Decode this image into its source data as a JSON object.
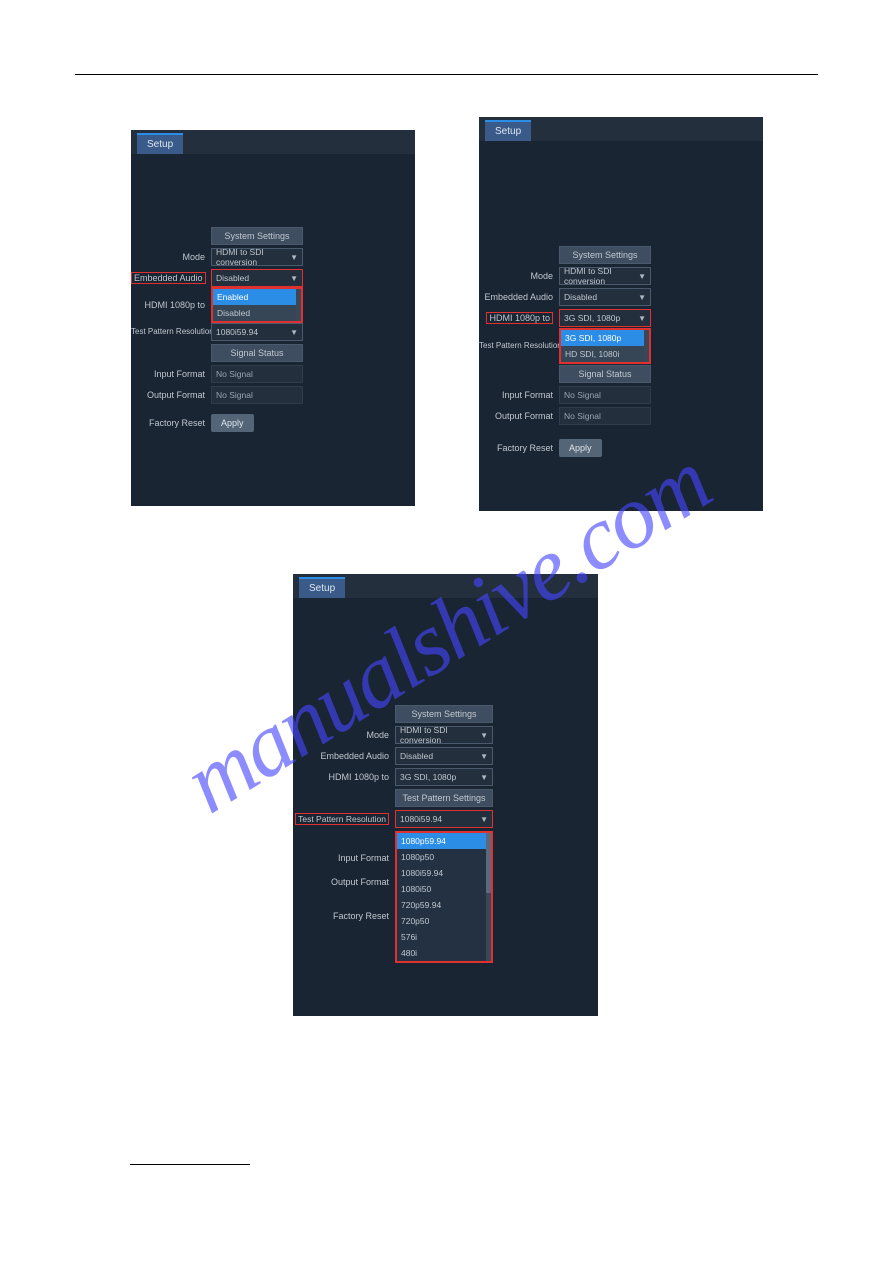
{
  "watermark": "manualshive.com",
  "tab_label": "Setup",
  "headers": {
    "system_settings": "System Settings",
    "test_pattern_settings": "Test Pattern Settings",
    "signal_status": "Signal Status"
  },
  "labels": {
    "mode": "Mode",
    "embedded_audio": "Embedded Audio",
    "hdmi_1080p_to": "HDMI 1080p to",
    "test_pattern_resolution": "Test Pattern Resolution",
    "input_format": "Input Format",
    "output_format": "Output Format",
    "factory_reset": "Factory Reset"
  },
  "values": {
    "mode": "HDMI to SDI conversion",
    "disabled": "Disabled",
    "sdi_1080p": "3G SDI, 1080p",
    "res_1080i5994": "1080i59.94",
    "no_signal": "No Signal",
    "apply": "Apply"
  },
  "panel1": {
    "dropdown": [
      "Enabled",
      "Disabled"
    ]
  },
  "panel2": {
    "dropdown": [
      "3G SDI, 1080p",
      "HD SDI, 1080i"
    ]
  },
  "panel3": {
    "dropdown": [
      "1080p59.94",
      "1080p50",
      "1080i59.94",
      "1080i50",
      "720p59.94",
      "720p50",
      "576i",
      "480i"
    ]
  }
}
